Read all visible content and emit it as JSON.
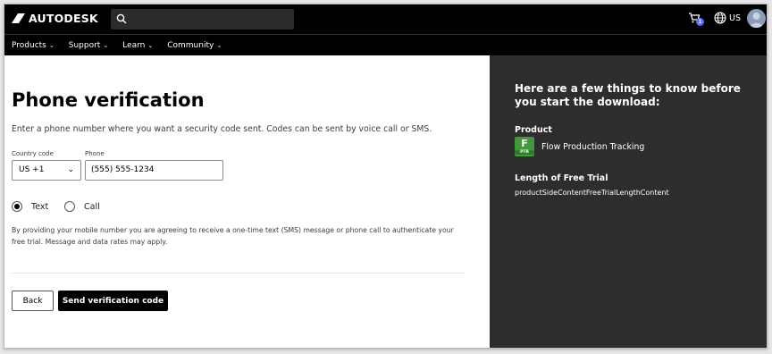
{
  "header": {
    "logo_text": "AUTODESK",
    "cart_count": "1",
    "language": "US"
  },
  "nav": {
    "items": [
      {
        "label": "Products"
      },
      {
        "label": "Support"
      },
      {
        "label": "Learn"
      },
      {
        "label": "Community"
      }
    ]
  },
  "form": {
    "title": "Phone verification",
    "lead": "Enter a phone number where you want a security code sent. Codes can be sent by voice call or SMS.",
    "country_label": "Country code",
    "country_value": "US +1",
    "phone_label": "Phone",
    "phone_value": "(555) 555-1234",
    "radio_text": "Text",
    "radio_call": "Call",
    "selected_method": "Text",
    "consent": "By providing your mobile number you are agreeing to receive a one-time text (SMS) message or phone call to authenticate your free trial. Message and data rates may apply.",
    "back_label": "Back",
    "send_label": "Send verification code"
  },
  "side": {
    "heading": "Here are a few things to know before you start the download:",
    "product_label": "Product",
    "product_icon_letter": "F",
    "product_icon_sub": "PTR",
    "product_name": "Flow Production Tracking",
    "trial_label": "Length of Free Trial",
    "trial_value": "productSideContentFreeTrialLengthContent"
  },
  "colors": {
    "topbar": "#000000",
    "side_panel": "#2d2d2d",
    "product_icon": "#3f9a3a",
    "cart_badge": "#5b6cff"
  }
}
